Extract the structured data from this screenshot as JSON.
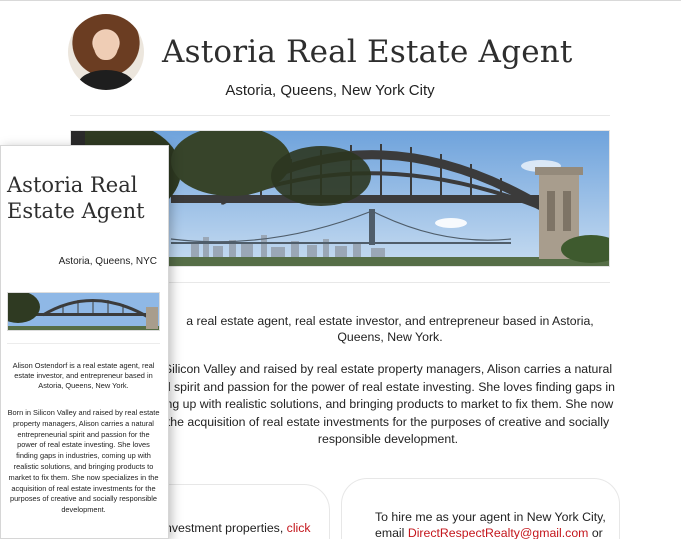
{
  "site": {
    "title": "Astoria Real Estate Agent",
    "tagline": "Astoria, Queens, New York City",
    "intro_partial": "a real estate agent, real estate investor, and entrepreneur based in Astoria, Queens, New York.",
    "bio_partial_lines": [
      "Silicon Valley and raised by real estate property managers, Alison carries a natural",
      "al spirit and passion for the power of real estate investing. She loves finding gaps in",
      "ing up with realistic solutions, and bringing products to market to fix them. She now",
      "the acquisition of real estate investments for the purposes of creative and socially",
      "responsible development."
    ],
    "card_left_text": "nvestment properties, ",
    "card_left_link": "click",
    "card_right_line1": "To hire me as your agent in New York City,",
    "card_right_prefix": "email ",
    "card_right_email": "DirectRespectRealty@gmail.com",
    "card_right_suffix": " or",
    "colors": {
      "link": "#c4161c",
      "title": "#2e2e2e",
      "sky": "#8fb8e6",
      "bridge": "#3b3b3b"
    },
    "hero_image": "hell-gate-bridge-photo",
    "avatar_image": "agent-portrait"
  },
  "mobile": {
    "title": "Astoria Real Estate Agent",
    "tagline": "Astoria, Queens, NYC",
    "intro": "Alison Ostendorf is a real estate agent, real estate investor, and entrepreneur based in Astoria, Queens, New York.",
    "bio": "Born in Silicon Valley and raised by real estate property managers, Alison carries a natural entrepreneurial spirit and passion for the power of real estate investing. She loves finding gaps in industries, coming up with realistic solutions, and bringing products to market to fix them. She now specializes in the acquisition of real estate investments for the purposes of creative and socially responsible development."
  }
}
